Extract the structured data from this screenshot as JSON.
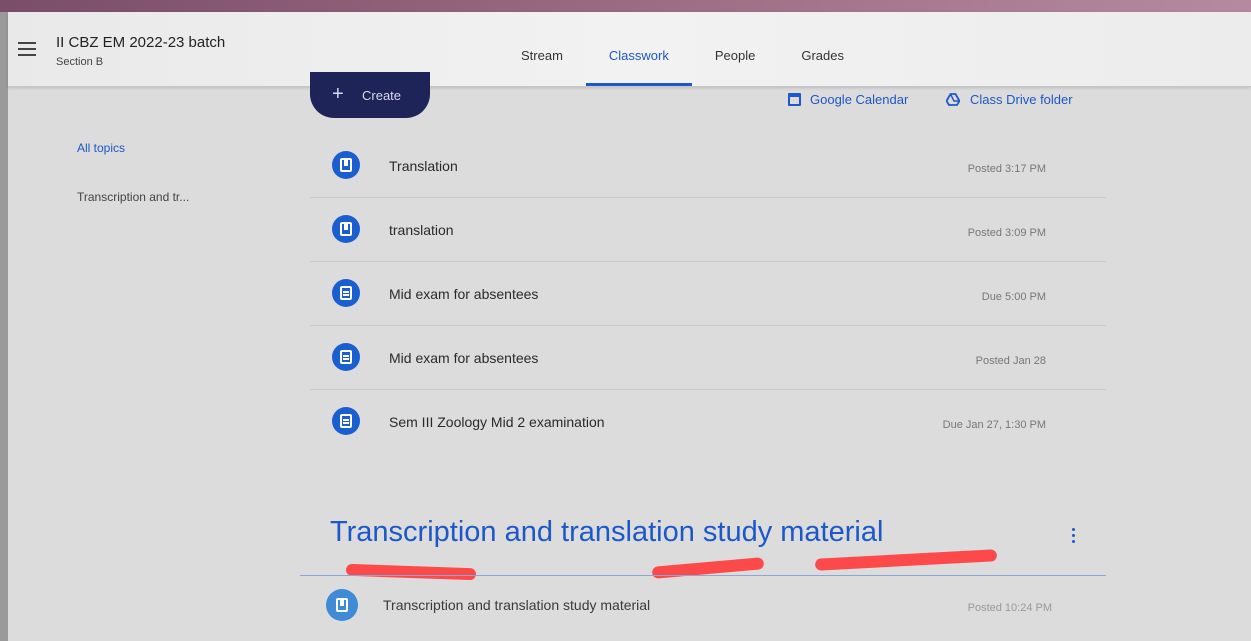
{
  "header": {
    "class_title": "II CBZ EM 2022-23 batch",
    "class_section": "Section B",
    "tabs": [
      {
        "label": "Stream"
      },
      {
        "label": "Classwork",
        "active": true
      },
      {
        "label": "People"
      },
      {
        "label": "Grades"
      }
    ]
  },
  "sidebar": {
    "items": [
      {
        "label": "All topics",
        "selected": true
      },
      {
        "label": "Transcription and tr..."
      }
    ]
  },
  "toolbar": {
    "create_label": "Create",
    "calendar_label": "Google Calendar",
    "drive_label": "Class Drive folder"
  },
  "classwork": [
    {
      "icon": "material-icon",
      "title": "Translation",
      "meta": "Posted 3:17 PM"
    },
    {
      "icon": "material-icon",
      "title": "translation",
      "meta": "Posted 3:09 PM"
    },
    {
      "icon": "assignment-icon",
      "title": "Mid exam for absentees",
      "meta": "Due 5:00 PM"
    },
    {
      "icon": "assignment-icon",
      "title": "Mid exam for absentees",
      "meta": "Posted Jan 28"
    },
    {
      "icon": "assignment-icon",
      "title": "Sem III Zoology Mid 2 examination",
      "meta": "Due Jan 27, 1:30 PM"
    }
  ],
  "topic": {
    "heading": "Transcription and translation study material",
    "items": [
      {
        "icon": "material-icon",
        "title": "Transcription and translation study material",
        "meta": "Posted 10:24 PM"
      }
    ]
  },
  "colors": {
    "accent": "#1c58c8",
    "create_button": "#1e2457",
    "icon_circle": "#1a5ecf",
    "annotation_red": "#ff3a3a"
  }
}
